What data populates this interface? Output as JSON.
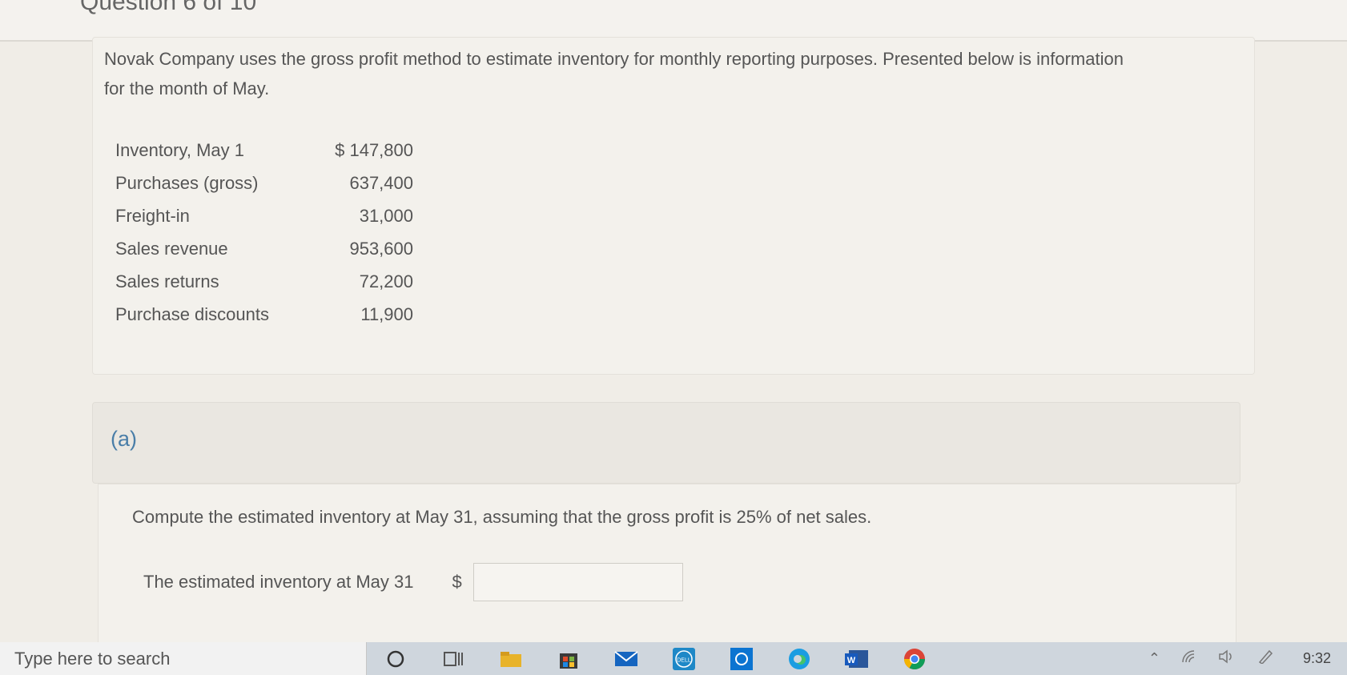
{
  "header": {
    "question_title": "Question 6 of 10"
  },
  "intro": {
    "text": "Novak Company uses the gross profit method to estimate inventory for monthly reporting purposes. Presented below is information for the month of May.",
    "rows": [
      {
        "label": "Inventory, May 1",
        "value": "$ 147,800"
      },
      {
        "label": "Purchases (gross)",
        "value": "637,400"
      },
      {
        "label": "Freight-in",
        "value": "31,000"
      },
      {
        "label": "Sales revenue",
        "value": "953,600"
      },
      {
        "label": "Sales returns",
        "value": "72,200"
      },
      {
        "label": "Purchase discounts",
        "value": "11,900"
      }
    ]
  },
  "part_a": {
    "label": "(a)",
    "question": "Compute the estimated inventory at May 31, assuming that the gross profit is 25% of net sales.",
    "answer_label": "The estimated inventory at May 31",
    "currency": "$",
    "answer_value": ""
  },
  "taskbar": {
    "search_placeholder": "Type here to search",
    "clock": "9:32",
    "word_letter": "W",
    "dell_text": "DELL"
  }
}
